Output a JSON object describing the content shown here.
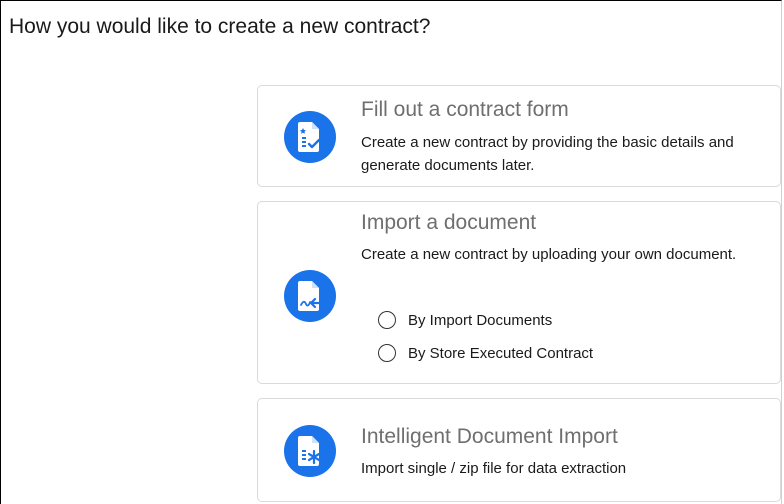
{
  "page": {
    "title": "How you would like to create a new contract?"
  },
  "options": [
    {
      "title": "Fill out a contract form",
      "description": "Create a new contract by providing the basic details and generate documents later.",
      "icon": "contract-form-icon"
    },
    {
      "title": "Import a document",
      "description": "Create a new contract by uploading your own document.",
      "icon": "import-document-icon",
      "radio_options": [
        {
          "label": "By Import Documents",
          "selected": false
        },
        {
          "label": "By Store Executed Contract",
          "selected": false
        }
      ]
    },
    {
      "title": "Intelligent Document Import",
      "description": "Import single / zip file for data extraction",
      "icon": "intelligent-import-icon"
    }
  ],
  "colors": {
    "accent": "#1a73e8",
    "card_border": "#d9d9d9",
    "card_title": "#6f6f6f"
  }
}
